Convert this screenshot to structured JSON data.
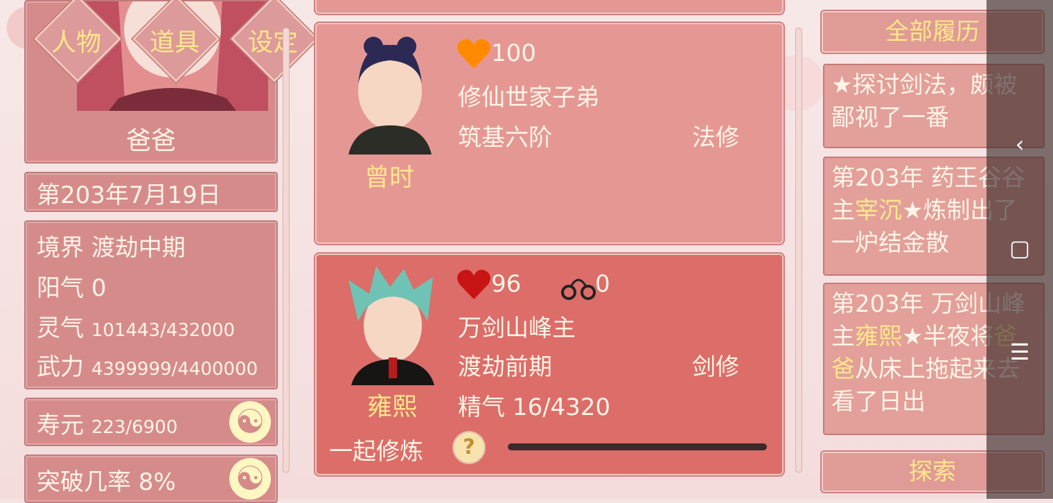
{
  "colors": {
    "accent": "#ffe78a",
    "panel": "#d68b8b",
    "active_card": "#dc6d69",
    "heart_orange": "#ff8a00",
    "heart_red": "#c81414"
  },
  "character": {
    "name": "爸爸"
  },
  "menu": {
    "tab1": "人物",
    "tab2": "道具",
    "tab3": "设定"
  },
  "date": "第203年7月19日",
  "stats": {
    "realm_label": "境界",
    "realm_value": "渡劫中期",
    "yang_label": "阳气",
    "yang_value": "0",
    "spirit_label": "灵气",
    "spirit_value": "101443/432000",
    "power_label": "武力",
    "power_value": "4399999/4400000",
    "life_label": "寿元",
    "life_value": "223/6900",
    "breakthrough_label": "突破几率",
    "breakthrough_value": "8%"
  },
  "cards": [
    {
      "name": "曾时",
      "affection": "100",
      "identity": "修仙世家子弟",
      "stage": "筑基六阶",
      "class": "法修",
      "heart_icon": "orange-heart-icon"
    },
    {
      "name": "雍熙",
      "affection": "96",
      "restraint": "0",
      "identity": "万剑山峰主",
      "stage": "渡劫前期",
      "class": "剑修",
      "essence": "精气 16/4320",
      "cultivate_label": "一起修炼",
      "help_symbol": "?",
      "heart_icon": "red-heart-icon"
    }
  ],
  "log": {
    "header": "全部履历",
    "entries": [
      {
        "parts": [
          {
            "t": "★探讨剑法，颇被鄙视了一番",
            "c": "#fff4e6"
          }
        ]
      },
      {
        "parts": [
          {
            "t": "第203年 药王谷谷主",
            "c": "#fff4e6"
          },
          {
            "t": "宰沉",
            "c": "#ffe78a"
          },
          {
            "t": "★炼制出了一炉结金散",
            "c": "#fff4e6"
          }
        ]
      },
      {
        "parts": [
          {
            "t": "第203年 万剑山峰主",
            "c": "#fff4e6"
          },
          {
            "t": "雍熙",
            "c": "#ffe78a"
          },
          {
            "t": "★半夜将",
            "c": "#fff4e6"
          },
          {
            "t": "爸爸",
            "c": "#ffe78a"
          },
          {
            "t": "从床上拖起来去看了日出",
            "c": "#fff4e6"
          }
        ]
      }
    ],
    "explore_label": "探索"
  },
  "navbar": {
    "back": "‹",
    "home": "▢",
    "menu": "☰"
  }
}
